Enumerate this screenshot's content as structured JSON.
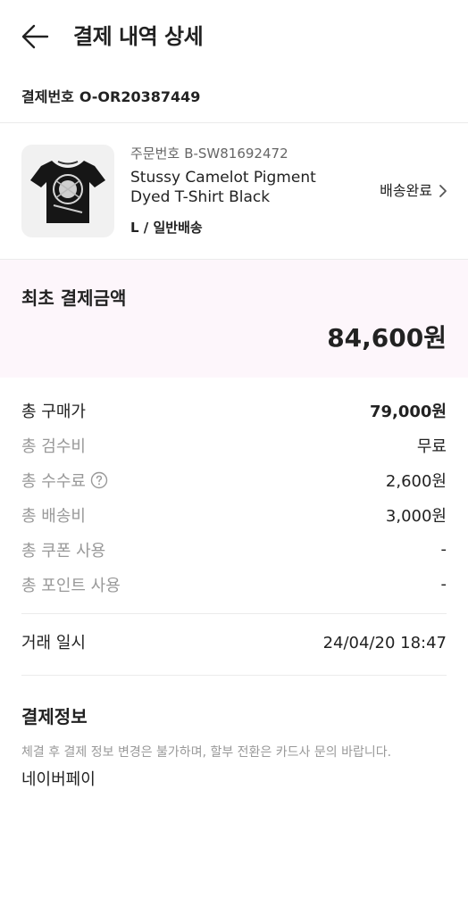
{
  "header": {
    "title": "결제 내역 상세",
    "back_icon": "arrow-left-icon"
  },
  "payment": {
    "number_label": "결제번호",
    "number": "O-OR20387449"
  },
  "product": {
    "order_label": "주문번호",
    "order_number": "B-SW81692472",
    "name": "Stussy Camelot Pigment Dyed T-Shirt Black",
    "option": "L / 일반배송",
    "status": "배송완료",
    "status_icon": "chevron-right-icon",
    "thumb_icon": "tshirt-icon"
  },
  "initial": {
    "label": "최초 결제금액",
    "amount": "84,600원"
  },
  "breakdown": {
    "purchase": {
      "label": "총 구매가",
      "value": "79,000원"
    },
    "inspection": {
      "label": "총 검수비",
      "value": "무료"
    },
    "fee": {
      "label": "총 수수료",
      "value": "2,600원",
      "icon": "question-circle-icon"
    },
    "shipping": {
      "label": "총 배송비",
      "value": "3,000원"
    },
    "coupon": {
      "label": "총 쿠폰 사용",
      "value": "-"
    },
    "point": {
      "label": "총 포인트 사용",
      "value": "-"
    }
  },
  "transaction": {
    "label": "거래 일시",
    "value": "24/04/20 18:47"
  },
  "payinfo": {
    "title": "결제정보",
    "note": "체결 후 결제 정보 변경은 불가하며, 할부 전환은 카드사 문의 바랍니다.",
    "method": "네이버페이"
  },
  "colors": {
    "highlight_bg": "#fdf6fb",
    "divider": "#ebebeb",
    "muted_text": "#999999"
  }
}
